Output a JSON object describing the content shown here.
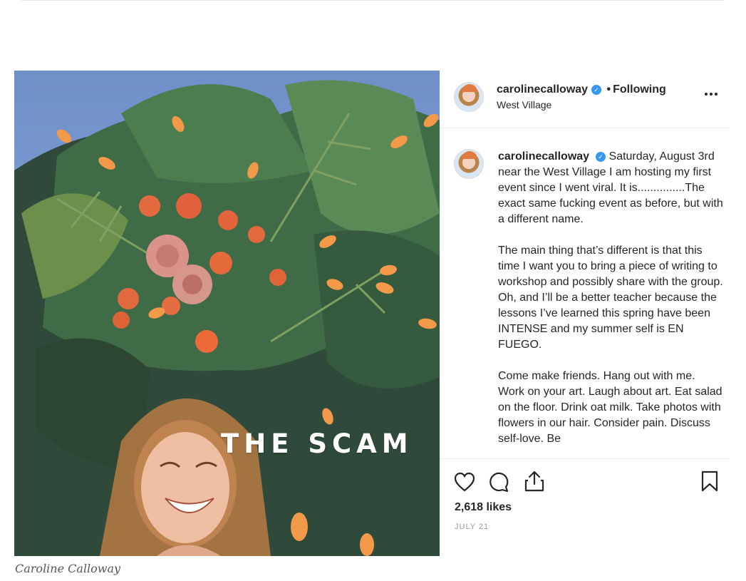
{
  "post": {
    "overlay_text": "THE SCAM",
    "author": {
      "username": "carolinecalloway",
      "verified_mark": "✓",
      "follow_sep": "•",
      "follow_status": "Following",
      "location": "West Village"
    },
    "caption": {
      "username": "carolinecalloway",
      "paragraphs": [
        "Saturday, August 3rd near the West Village I am hosting my first event since I went viral. It is...............The exact same fucking event as before, but with a different name.",
        "The main thing that’s different is that this time I want you to bring a piece of writing to workshop and possibly share with the group. Oh, and I’ll be a better teacher because the lessons I’ve learned this spring have been INTENSE and my summer self is EN FUEGO.",
        "Come make friends. Hang out with me. Work on your art. Laugh about art. Eat salad on the floor. Drink oat milk. Take photos with flowers in our hair. Consider pain. Discuss self-love. Be"
      ]
    },
    "actions": {
      "like_icon": "heart-icon",
      "comment_icon": "comment-icon",
      "share_icon": "share-icon",
      "save_icon": "bookmark-icon"
    },
    "likes": "2,618 likes",
    "date": "JULY 21"
  },
  "photo_caption": "Caroline Calloway",
  "colors": {
    "verified_badge": "#3897f0",
    "text_primary": "#262626",
    "text_muted": "#999999"
  }
}
